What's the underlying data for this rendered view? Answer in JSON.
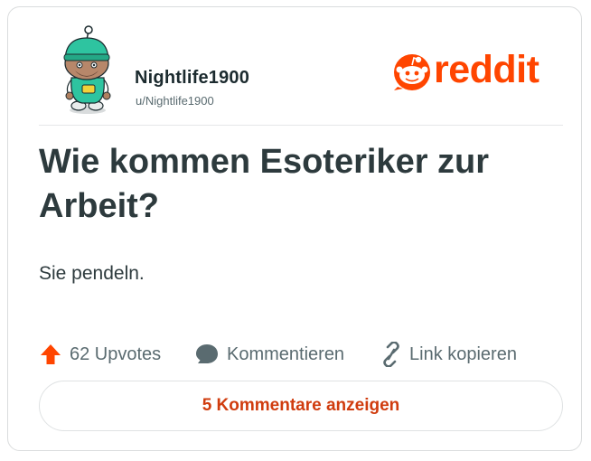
{
  "author": {
    "display_name": "Nightlife1900",
    "handle": "u/Nightlife1900",
    "avatar_icon": "snoo-avatar-icon"
  },
  "brand": {
    "name": "reddit",
    "color": "#ff4500"
  },
  "post": {
    "title": "Wie kommen Esoteriker zur Arbeit?",
    "body": "Sie pendeln."
  },
  "actions": {
    "upvotes_label": "62 Upvotes",
    "upvote_icon": "upvote-arrow-icon",
    "comment_label": "Kommentieren",
    "comment_icon": "comment-bubble-icon",
    "copy_link_label": "Link kopieren",
    "link_icon": "link-icon"
  },
  "comments_button": {
    "label": "5 Kommentare anzeigen"
  }
}
